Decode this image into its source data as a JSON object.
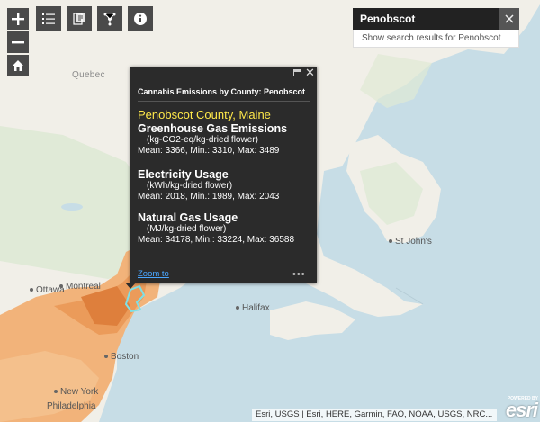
{
  "toolbar": {
    "zoom_in_icon": "plus-icon",
    "zoom_out_icon": "minus-icon",
    "home_icon": "home-icon",
    "legend_icon": "list-icon",
    "layers_icon": "layers-icon",
    "share_icon": "share-icon",
    "info_icon": "info-icon"
  },
  "search": {
    "value": "Penobscot",
    "suggestion": "Show search results for Penobscot"
  },
  "map": {
    "country_label": "Quebec",
    "places": [
      "St John's",
      "Ottawa",
      "Montreal",
      "Halifax",
      "Boston",
      "New York",
      "Philadelphia"
    ]
  },
  "popup": {
    "title": "Cannabis Emissions by County: Penobscot",
    "county": "Penobscot County, Maine",
    "sections": [
      {
        "heading": "Greenhouse Gas Emissions",
        "unit": "(kg-CO2-eq/kg-dried flower)",
        "values": "Mean: 3366, Min.: 3310, Max: 3489"
      },
      {
        "heading": "Electricity Usage",
        "unit": "(kWh/kg-dried flower)",
        "values": "Mean: 2018, Min.: 1989, Max: 2043"
      },
      {
        "heading": "Natural Gas Usage",
        "unit": "(MJ/kg-dried flower)",
        "values": "Mean: 34178, Min.: 33224, Max: 36588"
      }
    ],
    "zoom_link": "Zoom to",
    "more": "•••"
  },
  "attribution": "Esri, USGS | Esri, HERE, Garmin, FAO, NOAA, USGS, NRC...",
  "logo": {
    "powered": "POWERED BY",
    "text": "esri"
  },
  "colors": {
    "popup_bg": "#2b2b2b",
    "county_title": "#ffe94a",
    "link": "#4aa6ff",
    "highlight": "#7fe0e6"
  }
}
